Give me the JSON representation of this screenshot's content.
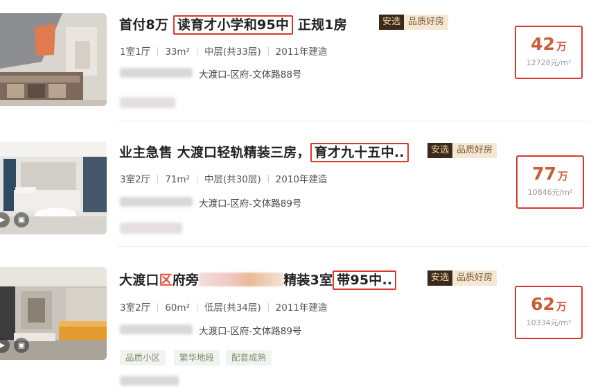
{
  "listings": [
    {
      "title_pre": "首付8万 ",
      "title_hl": "读育才小学和95中",
      "title_post": " 正规1房",
      "tag_a": "安选",
      "tag_b": "品质好房",
      "layout": "1室1厅",
      "area": "33m²",
      "floor": "中层(共33层)",
      "built": "2011年建造",
      "address": "大渡口-区府-文体路88号",
      "price": "42",
      "price_unit": "万",
      "unit_price": "12728元/m²",
      "features": []
    },
    {
      "title_pre": "业主急售 大渡口轻轨精装三房，",
      "title_hl": "育才九十五中..",
      "title_post": "",
      "tag_a": "安选",
      "tag_b": "品质好房",
      "layout": "3室2厅",
      "area": "71m²",
      "floor": "中层(共30层)",
      "built": "2010年建造",
      "address": "大渡口-区府-文体路89号",
      "price": "77",
      "price_unit": "万",
      "unit_price": "10846元/m²",
      "features": []
    },
    {
      "title_a": "大渡口",
      "title_red": "区",
      "title_b": "府旁",
      "title_c": "精装3室",
      "title_hl": "带95中..",
      "tag_a": "安选",
      "tag_b": "品质好房",
      "layout": "3室2厅",
      "area": "60m²",
      "floor": "低层(共34层)",
      "built": "2011年建造",
      "address": "大渡口-区府-文体路89号",
      "price": "62",
      "price_unit": "万",
      "unit_price": "10334元/m²",
      "features": [
        "品质小区",
        "繁华地段",
        "配套成熟"
      ]
    }
  ],
  "icons": {
    "play": "play-icon",
    "gallery": "gallery-icon"
  }
}
